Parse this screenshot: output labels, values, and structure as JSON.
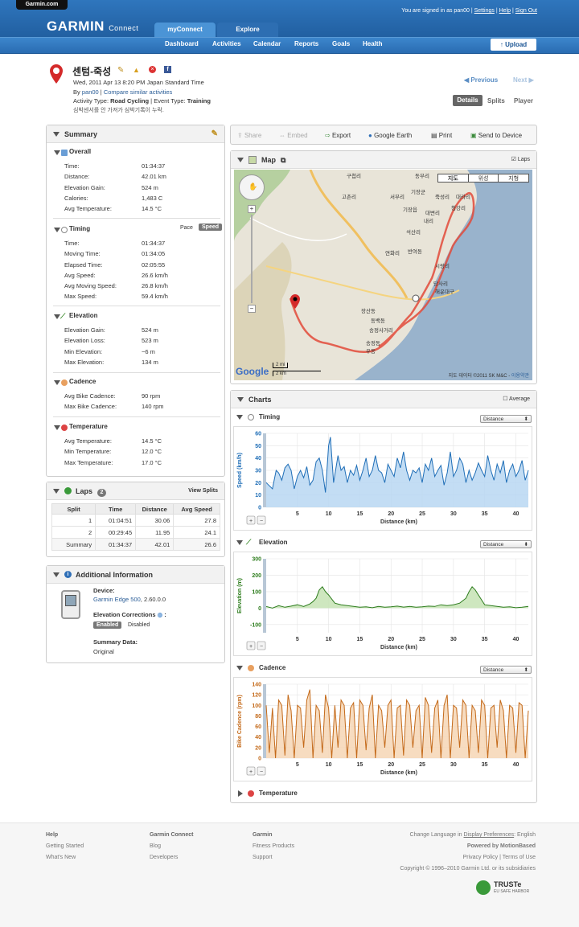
{
  "header": {
    "garmin_tab": "Garmin.com",
    "logo": "GARMIN",
    "logo_sub": "Connect",
    "signed_in": "You are signed in as pan00",
    "settings": "Settings",
    "help": "Help",
    "sign_out": "Sign Out",
    "tabs": [
      "myConnect",
      "Explore"
    ],
    "nav": [
      "Dashboard",
      "Activities",
      "Calendar",
      "Reports",
      "Goals",
      "Health"
    ],
    "upload": "Upload"
  },
  "activity": {
    "title": "센텀-죽성",
    "date": "Wed, 2011 Apr 13 8:20 PM Japan Standard Time",
    "by_label": "By",
    "user": "pan00",
    "compare": "Compare similar activities",
    "type_label": "Activity Type:",
    "type": "Road Cycling",
    "event_label": "Event Type:",
    "event": "Training",
    "note": "심박센서를 안 가져가 심박기록이 누락.",
    "previous": "Previous",
    "next": "Next",
    "views": [
      "Details",
      "Splits",
      "Player"
    ]
  },
  "summary": {
    "title": "Summary",
    "overall": {
      "title": "Overall",
      "rows": [
        {
          "k": "Time:",
          "v": "01:34:37"
        },
        {
          "k": "Distance:",
          "v": "42.01 km"
        },
        {
          "k": "Elevation Gain:",
          "v": "524 m"
        },
        {
          "k": "Calories:",
          "v": "1,483 C"
        },
        {
          "k": "Avg Temperature:",
          "v": "14.5 °C"
        }
      ]
    },
    "timing": {
      "title": "Timing",
      "pace": "Pace",
      "speed": "Speed",
      "rows": [
        {
          "k": "Time:",
          "v": "01:34:37"
        },
        {
          "k": "Moving Time:",
          "v": "01:34:05"
        },
        {
          "k": "Elapsed Time:",
          "v": "02:05:55"
        },
        {
          "k": "Avg Speed:",
          "v": "26.6 km/h"
        },
        {
          "k": "Avg Moving Speed:",
          "v": "26.8 km/h"
        },
        {
          "k": "Max Speed:",
          "v": "59.4 km/h"
        }
      ]
    },
    "elevation": {
      "title": "Elevation",
      "rows": [
        {
          "k": "Elevation Gain:",
          "v": "524 m"
        },
        {
          "k": "Elevation Loss:",
          "v": "523 m"
        },
        {
          "k": "Min Elevation:",
          "v": "−6 m"
        },
        {
          "k": "Max Elevation:",
          "v": "134 m"
        }
      ]
    },
    "cadence": {
      "title": "Cadence",
      "rows": [
        {
          "k": "Avg Bike Cadence:",
          "v": "90 rpm"
        },
        {
          "k": "Max Bike Cadence:",
          "v": "140 rpm"
        }
      ]
    },
    "temperature": {
      "title": "Temperature",
      "rows": [
        {
          "k": "Avg Temperature:",
          "v": "14.5 °C"
        },
        {
          "k": "Min Temperature:",
          "v": "12.0 °C"
        },
        {
          "k": "Max Temperature:",
          "v": "17.0 °C"
        }
      ]
    }
  },
  "laps": {
    "title": "Laps",
    "count": "2",
    "view_splits": "View Splits",
    "headers": [
      "Split",
      "Time",
      "Distance",
      "Avg Speed"
    ],
    "rows": [
      [
        "1",
        "01:04:51",
        "30.06",
        "27.8"
      ],
      [
        "2",
        "00:29:45",
        "11.95",
        "24.1"
      ],
      [
        "Summary",
        "01:34:37",
        "42.01",
        "26.6"
      ]
    ]
  },
  "additional": {
    "title": "Additional Information",
    "device_label": "Device:",
    "device": "Garmin Edge 500",
    "version": ", 2.60.0.0",
    "elev_corr_label": "Elevation Corrections",
    "enabled": "Enabled",
    "disabled": "Disabled",
    "summary_data_label": "Summary Data:",
    "summary_data": "Original"
  },
  "toolbar": {
    "items": [
      "Share",
      "Embed",
      "Export",
      "Google Earth",
      "Print",
      "Send to Device"
    ]
  },
  "map": {
    "title": "Map",
    "laps_label": "Laps",
    "types": [
      "지도",
      "위성",
      "지형"
    ],
    "copyright": "지도 데이터 ©2011 SK M&C",
    "terms": "이용약관",
    "scale_mi": "2 mi",
    "scale_km": "2 km",
    "google": "Google",
    "labels": [
      "구첩리",
      "고촌리",
      "서부리",
      "동부리",
      "기장군",
      "죽성리",
      "대라리",
      "기장읍",
      "대변리",
      "내리",
      "청강리",
      "연화리",
      "석산리",
      "시랑리",
      "당사리",
      "해운대구",
      "송정동",
      "동백동",
      "송정사거리",
      "반여동",
      "장산동",
      "우동"
    ]
  },
  "charts": {
    "title": "Charts",
    "average": "Average",
    "dropdown": "Distance",
    "temperature_title": "Temperature"
  },
  "chart_data": [
    {
      "type": "area",
      "title": "Timing",
      "xlabel": "Distance (km)",
      "ylabel": "Speed (km/h)",
      "xlim": [
        0,
        42
      ],
      "ylim": [
        0,
        60
      ],
      "xticks": [
        5,
        10,
        15,
        20,
        25,
        30,
        35,
        40
      ],
      "yticks": [
        0,
        10,
        20,
        30,
        40,
        50,
        60
      ],
      "color": "#1f6eb7",
      "fill": "#b9d7f2",
      "x": [
        0,
        1,
        1.6,
        2,
        2.5,
        3,
        3.5,
        4,
        4.5,
        5,
        5.5,
        6,
        6.5,
        7,
        7.5,
        8,
        8.5,
        9,
        9.5,
        10,
        10.3,
        10.8,
        11.5,
        12,
        12.5,
        13,
        13.5,
        14,
        14.5,
        15,
        15.5,
        16,
        16.5,
        17,
        17.5,
        18,
        18.5,
        19,
        19.5,
        20,
        20.5,
        21,
        21.5,
        22,
        22.5,
        23,
        23.5,
        24,
        24.5,
        25,
        25.5,
        26,
        26.5,
        27,
        27.5,
        28,
        28.5,
        29,
        29.5,
        30,
        30.5,
        31,
        31.5,
        32,
        32.5,
        33,
        33.5,
        34,
        34.5,
        35,
        35.5,
        36,
        36.5,
        37,
        37.5,
        38,
        38.5,
        39,
        39.5,
        40,
        40.5,
        41,
        41.5,
        42
      ],
      "values": [
        20,
        15,
        30,
        28,
        22,
        32,
        35,
        30,
        15,
        25,
        30,
        24,
        33,
        18,
        22,
        37,
        40,
        30,
        12,
        50,
        57,
        20,
        42,
        30,
        33,
        20,
        30,
        26,
        34,
        22,
        30,
        40,
        25,
        30,
        42,
        30,
        28,
        20,
        35,
        30,
        25,
        40,
        32,
        45,
        30,
        22,
        30,
        28,
        32,
        20,
        35,
        30,
        40,
        25,
        30,
        34,
        18,
        28,
        45,
        25,
        30,
        40,
        35,
        20,
        30,
        22,
        28,
        36,
        30,
        25,
        42,
        30,
        22,
        35,
        28,
        38,
        20,
        30,
        35,
        25,
        30,
        38,
        22,
        30
      ]
    },
    {
      "type": "area",
      "title": "Elevation",
      "xlabel": "Distance (km)",
      "ylabel": "Elevation (m)",
      "xlim": [
        0,
        42
      ],
      "ylim": [
        -150,
        300
      ],
      "xticks": [
        5,
        10,
        15,
        20,
        25,
        30,
        35,
        40
      ],
      "yticks": [
        -100,
        0,
        100,
        200,
        300
      ],
      "color": "#2e7d1e",
      "fill": "#c6e3b4",
      "x": [
        0,
        1,
        2,
        3,
        4,
        5,
        6,
        7,
        7.5,
        8,
        8.5,
        9,
        9.5,
        10,
        11,
        12,
        13,
        14,
        15,
        16,
        17,
        18,
        19,
        20,
        21,
        22,
        23,
        24,
        25,
        26,
        27,
        28,
        29,
        30,
        31,
        32,
        32.5,
        33,
        33.5,
        34,
        35,
        36,
        37,
        38,
        39,
        40,
        41,
        42
      ],
      "values": [
        10,
        0,
        15,
        5,
        12,
        20,
        10,
        25,
        40,
        60,
        110,
        130,
        100,
        80,
        30,
        20,
        15,
        10,
        5,
        8,
        2,
        10,
        5,
        8,
        12,
        6,
        10,
        5,
        8,
        12,
        10,
        20,
        15,
        20,
        30,
        60,
        100,
        130,
        110,
        80,
        20,
        15,
        10,
        5,
        8,
        2,
        5,
        10
      ]
    },
    {
      "type": "area",
      "title": "Cadence",
      "xlabel": "Distance (km)",
      "ylabel": "Bike Cadence (rpm)",
      "xlim": [
        0,
        42
      ],
      "ylim": [
        0,
        140
      ],
      "xticks": [
        5,
        10,
        15,
        20,
        25,
        30,
        35,
        40
      ],
      "yticks": [
        0,
        20,
        40,
        60,
        80,
        100,
        120,
        140
      ],
      "color": "#c46a1a",
      "fill": "#f6d6b5",
      "x": [
        0,
        0.5,
        1,
        1.5,
        2,
        2.5,
        3,
        3.5,
        4,
        4.5,
        5,
        5.5,
        6,
        6.5,
        7,
        7.5,
        8,
        8.5,
        9,
        9.5,
        10,
        10.5,
        11,
        11.5,
        12,
        12.5,
        13,
        13.5,
        14,
        14.5,
        15,
        15.5,
        16,
        16.5,
        17,
        17.5,
        18,
        18.5,
        19,
        19.5,
        20,
        20.5,
        21,
        21.5,
        22,
        22.5,
        23,
        23.5,
        24,
        24.5,
        25,
        25.5,
        26,
        26.5,
        27,
        27.5,
        28,
        28.5,
        29,
        29.5,
        30,
        30.5,
        31,
        31.5,
        32,
        32.5,
        33,
        33.5,
        34,
        34.5,
        35,
        35.5,
        36,
        36.5,
        37,
        37.5,
        38,
        38.5,
        39,
        39.5,
        40,
        40.5,
        41,
        41.5,
        42
      ],
      "values": [
        100,
        10,
        95,
        0,
        110,
        100,
        5,
        120,
        90,
        0,
        100,
        95,
        20,
        110,
        130,
        0,
        100,
        90,
        10,
        120,
        95,
        0,
        100,
        20,
        110,
        100,
        0,
        95,
        105,
        0,
        110,
        100,
        15,
        95,
        120,
        0,
        100,
        90,
        20,
        100,
        110,
        0,
        95,
        100,
        5,
        110,
        100,
        20,
        90,
        100,
        0,
        115,
        100,
        10,
        95,
        110,
        0,
        100,
        120,
        0,
        100,
        95,
        20,
        110,
        100,
        0,
        100,
        90,
        10,
        110,
        100,
        0,
        95,
        100,
        20,
        110,
        90,
        0,
        100,
        95,
        10,
        105,
        100,
        0,
        90
      ]
    }
  ],
  "footer": {
    "cols": [
      {
        "title": "Help",
        "links": [
          "Getting Started",
          "What's New"
        ]
      },
      {
        "title": "Garmin Connect",
        "links": [
          "Blog",
          "Developers"
        ]
      },
      {
        "title": "Garmin",
        "links": [
          "Fitness Products",
          "Support"
        ]
      }
    ],
    "change_lang": "Change Language in",
    "display_prefs": "Display Preferences",
    "lang": ": English",
    "powered": "Powered by MotionBased",
    "privacy": "Privacy Policy",
    "terms": "Terms of Use",
    "copyright": "Copyright © 1996–2010 Garmin Ltd. or its subsidiaries",
    "truste": "TRUSTe",
    "truste_sub": "EU SAFE HARBOR"
  }
}
